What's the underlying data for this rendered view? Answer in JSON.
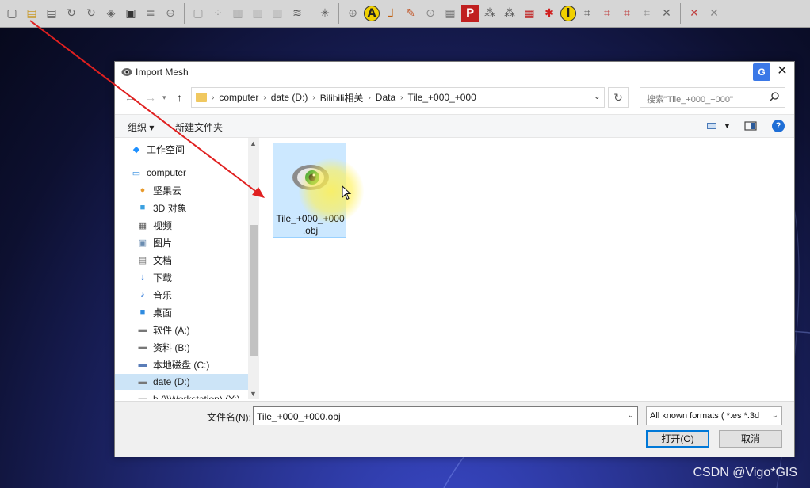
{
  "toolbar": {
    "icons": [
      "new-file-icon",
      "open-folder-icon",
      "open-project-icon",
      "rotate-icon",
      "rotate-mesh-icon",
      "mesh-layers-icon",
      "camera-icon",
      "stack-icon",
      "globe-icon",
      "bounding-box-icon",
      "points-icon",
      "box-wire-icon",
      "bars-icon",
      "bars-light-icon",
      "layers-icon",
      "axis-icon",
      "globe2-icon",
      "annotation-a-icon",
      "axis-lines-icon",
      "brush-icon",
      "lighting-icon",
      "paint-icon",
      "p-icon",
      "select-points-icon",
      "select-faces-icon",
      "color-icon",
      "star-icon",
      "info-icon",
      "pick-icon",
      "poly-icon",
      "poly2-icon",
      "poly3-icon",
      "cross-icon",
      "cross2-icon",
      "cross3-icon"
    ],
    "annotation_letter": "A",
    "info_letter": "i",
    "p_letter": "P"
  },
  "dialog": {
    "title": "Import Mesh",
    "translate_label": "G",
    "close_label": "✕",
    "breadcrumbs": [
      "computer",
      "date (D:)",
      "Bilibili相关",
      "Data",
      "Tile_+000_+000"
    ],
    "search_placeholder": "搜索\"Tile_+000_+000\"",
    "organize_label": "组织 ▾",
    "new_folder_label": "新建文件夹",
    "help_label": "?",
    "nav_items": [
      {
        "label": "工作空间",
        "icon": "workspace-icon",
        "glyph": "◆",
        "color": "#1e90ff"
      },
      {
        "label": "computer",
        "icon": "computer-icon",
        "glyph": "▭",
        "color": "#2f8be0"
      },
      {
        "label": "坚果云",
        "icon": "nutstore-icon",
        "glyph": "●",
        "color": "#e89a2c"
      },
      {
        "label": "3D 对象",
        "icon": "3d-objects-icon",
        "glyph": "■",
        "color": "#3aa0e0"
      },
      {
        "label": "视频",
        "icon": "video-icon",
        "glyph": "▦",
        "color": "#555"
      },
      {
        "label": "图片",
        "icon": "pictures-icon",
        "glyph": "▣",
        "color": "#6a8cb0"
      },
      {
        "label": "文档",
        "icon": "documents-icon",
        "glyph": "▤",
        "color": "#777"
      },
      {
        "label": "下载",
        "icon": "downloads-icon",
        "glyph": "↓",
        "color": "#1e6ed6"
      },
      {
        "label": "音乐",
        "icon": "music-icon",
        "glyph": "♪",
        "color": "#1e6ed6"
      },
      {
        "label": "桌面",
        "icon": "desktop-icon",
        "glyph": "■",
        "color": "#2f8be0"
      },
      {
        "label": "软件 (A:)",
        "icon": "drive-a-icon",
        "glyph": "▬",
        "color": "#777"
      },
      {
        "label": "资料 (B:)",
        "icon": "drive-b-icon",
        "glyph": "▬",
        "color": "#777"
      },
      {
        "label": "本地磁盘 (C:)",
        "icon": "drive-c-icon",
        "glyph": "▬",
        "color": "#5a7db8"
      },
      {
        "label": "date (D:)",
        "icon": "drive-d-icon",
        "glyph": "▬",
        "color": "#777"
      },
      {
        "label": "h (\\\\Workstation) (Y:)",
        "icon": "network-drive-icon",
        "glyph": "▬",
        "color": "#777"
      }
    ],
    "selected_nav": "date (D:)",
    "file": {
      "name_line1": "Tile_+000_+000",
      "name_line2": ".obj"
    },
    "filename_label": "文件名(N):",
    "filename_value": "Tile_+000_+000.obj",
    "filetype_value": "All known formats ( *.es *.3d",
    "open_label": "打开(O)",
    "cancel_label": "取消"
  },
  "watermark": "CSDN @Vigo*GIS",
  "colors": {
    "accent": "#0078d7",
    "selection": "#cce8ff",
    "arrow": "#e02020"
  }
}
